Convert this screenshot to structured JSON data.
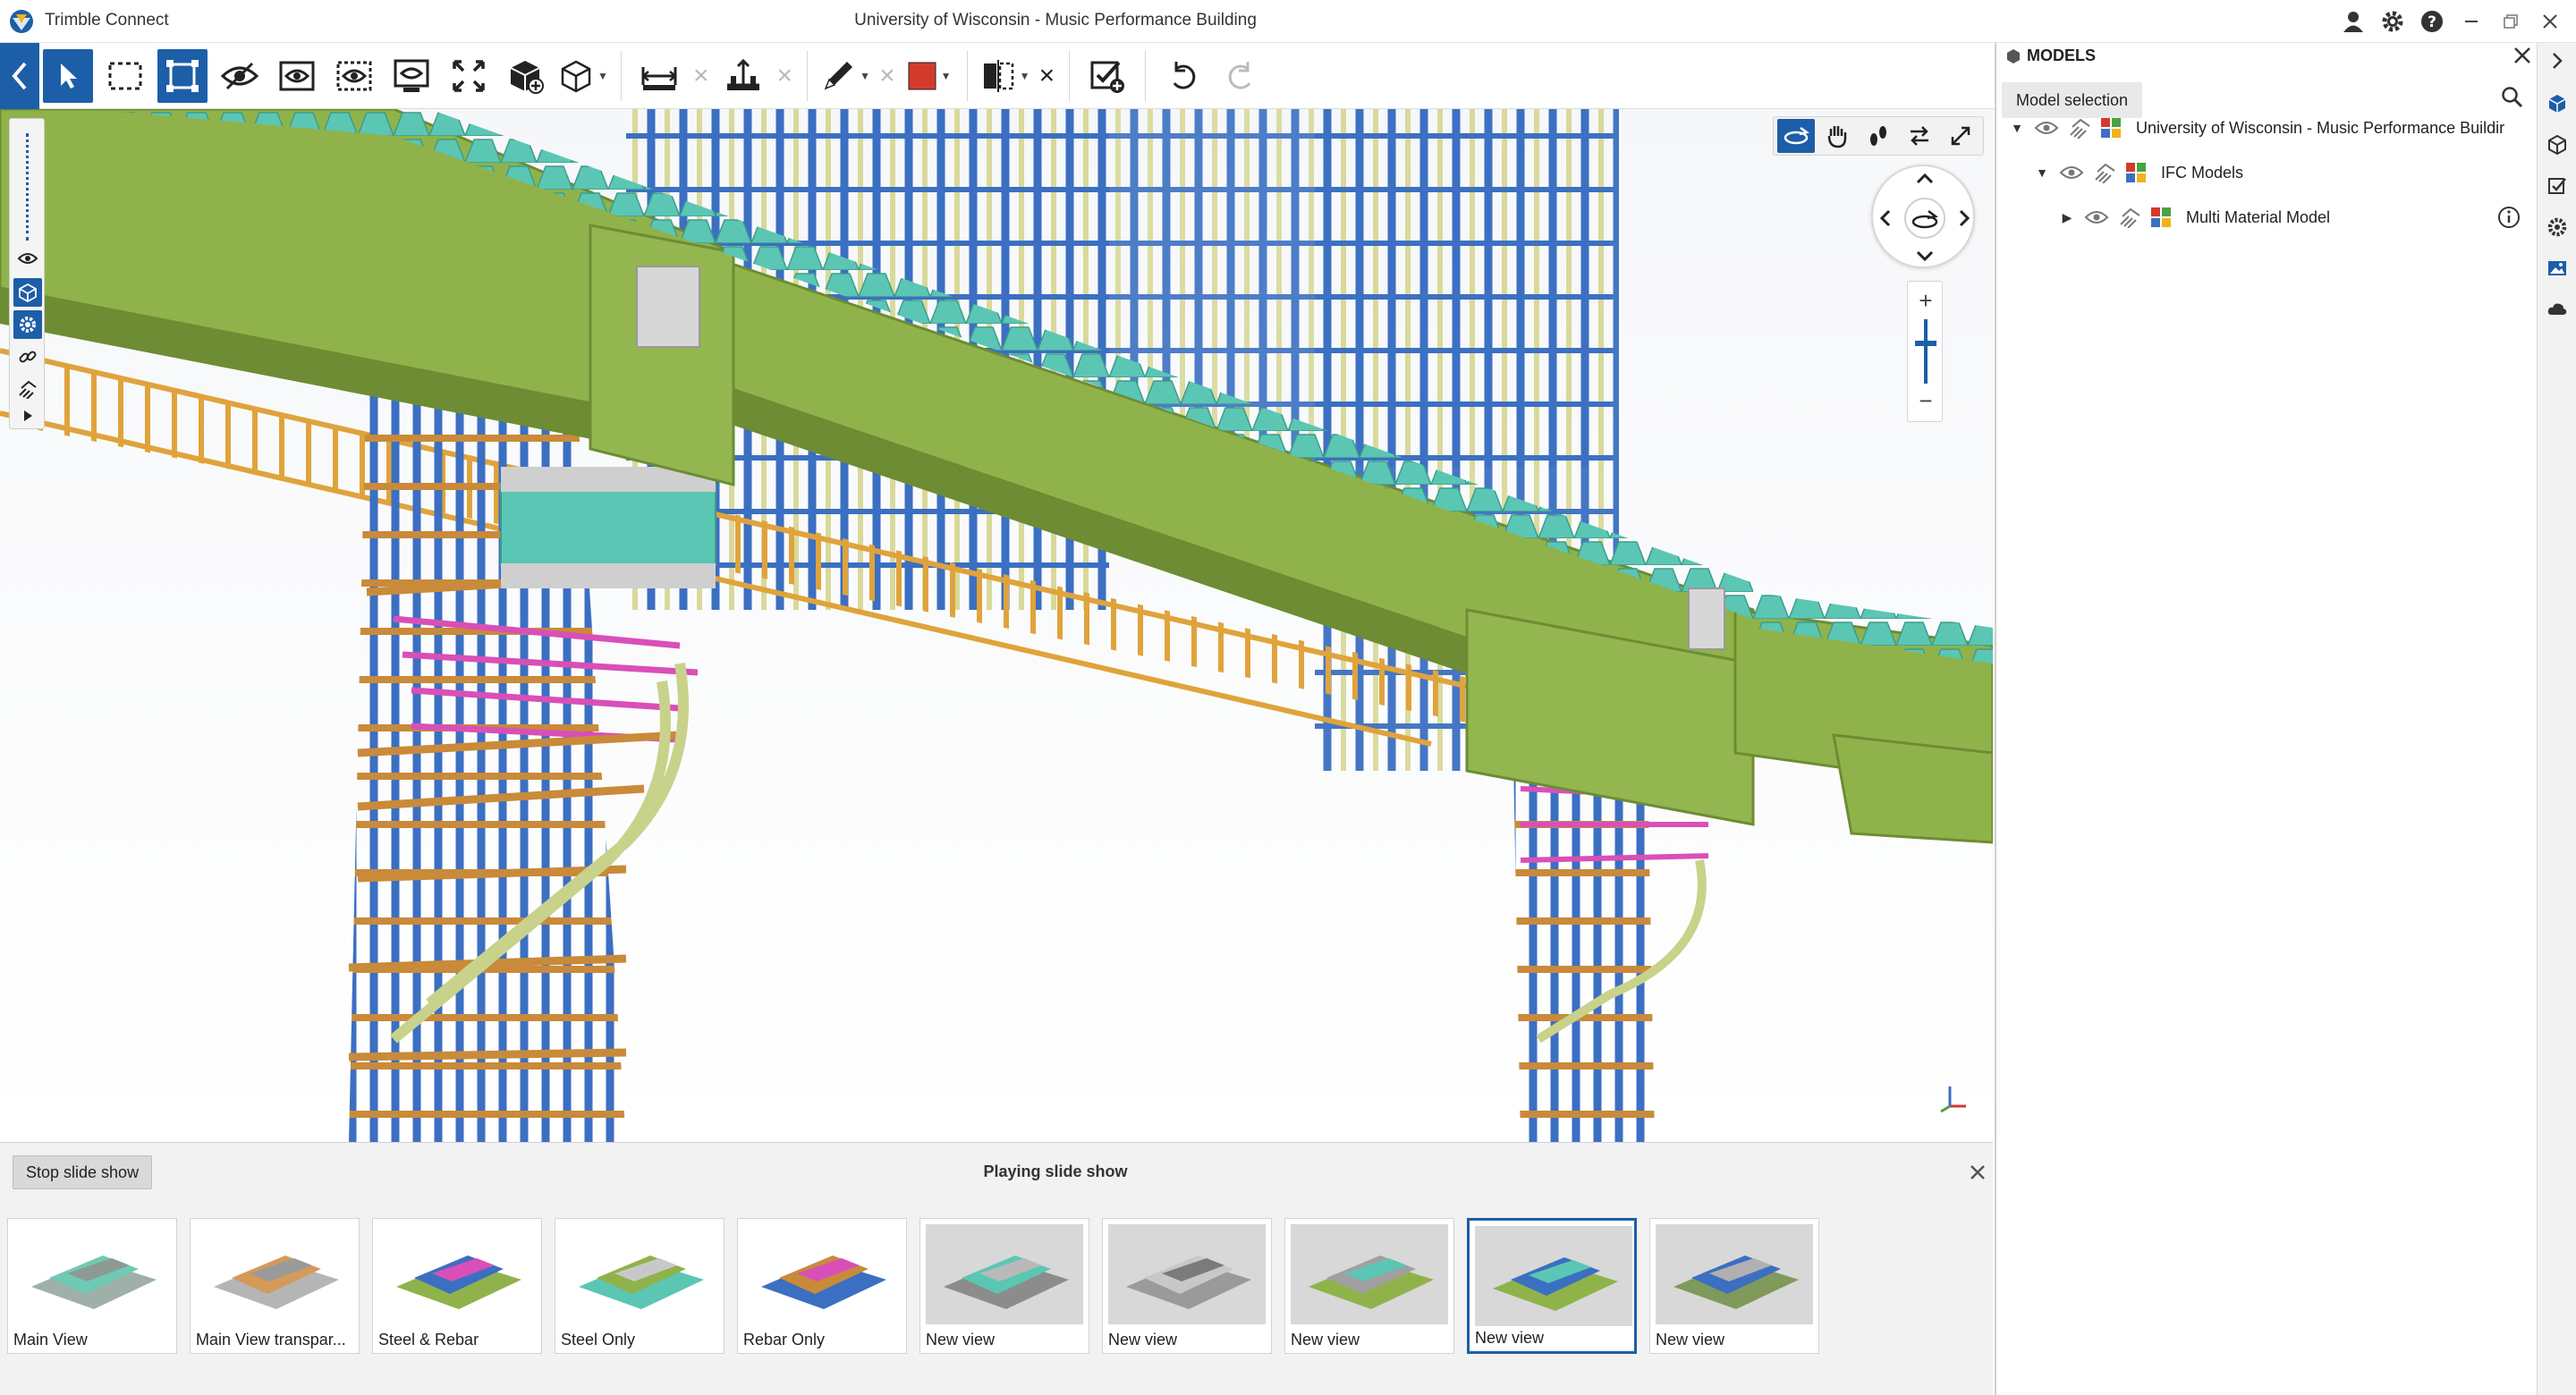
{
  "app": {
    "name": "Trimble Connect",
    "window_title": "University of Wisconsin - Music Performance Building"
  },
  "colors": {
    "accent": "#1d5ea8",
    "steel_green": "#8fb34a",
    "deck_teal": "#5bc6b4",
    "rebar_blue": "#3b6fc2",
    "rebar_orange": "#c98a3a",
    "rebar_magenta": "#d94fb8",
    "color_tool_red": "#d33a2c"
  },
  "toolbar": {
    "tools": [
      {
        "icon": "back-arrow-icon"
      },
      {
        "icon": "select-arrow-icon"
      },
      {
        "icon": "box-select-icon"
      },
      {
        "icon": "fit-select-icon"
      },
      {
        "icon": "hide-icon"
      },
      {
        "icon": "isolate-icon"
      },
      {
        "icon": "show-all-icon"
      },
      {
        "icon": "ghost-icon"
      },
      {
        "icon": "fit-all-icon"
      },
      {
        "icon": "add-object-icon"
      },
      {
        "icon": "cube-view-icon"
      },
      {
        "icon": "measure-icon"
      },
      {
        "icon": "measure-height-icon"
      },
      {
        "icon": "markup-pen-icon"
      },
      {
        "icon": "color-box-icon"
      },
      {
        "icon": "section-plane-icon"
      },
      {
        "icon": "create-todo-icon"
      },
      {
        "icon": "undo-icon"
      },
      {
        "icon": "redo-icon"
      }
    ]
  },
  "navigation": {
    "tools": [
      "orbit-icon",
      "pan-icon",
      "walk-icon",
      "swap-icon",
      "fullscreen-icon"
    ]
  },
  "slideshow": {
    "stop_label": "Stop slide show",
    "title": "Playing slide show",
    "selected_index": 8,
    "slides": [
      {
        "label": "Main View"
      },
      {
        "label": "Main View transpar..."
      },
      {
        "label": "Steel & Rebar"
      },
      {
        "label": "Steel Only"
      },
      {
        "label": "Rebar Only"
      },
      {
        "label": "New view"
      },
      {
        "label": "New view"
      },
      {
        "label": "New view"
      },
      {
        "label": "New view"
      },
      {
        "label": "New view"
      }
    ]
  },
  "models_panel": {
    "title": "MODELS",
    "selection_button": "Model selection",
    "tree": [
      {
        "label": "University of Wisconsin - Music Performance Buildir",
        "depth": 0,
        "expanded": true
      },
      {
        "label": "IFC Models",
        "depth": 1,
        "expanded": true
      },
      {
        "label": "Multi Material Model",
        "depth": 2,
        "expanded": false
      }
    ]
  },
  "sidebar": {
    "items": [
      "models-icon",
      "objects-icon",
      "todo-icon",
      "settings-icon",
      "views-icon",
      "cloud-icon"
    ]
  }
}
